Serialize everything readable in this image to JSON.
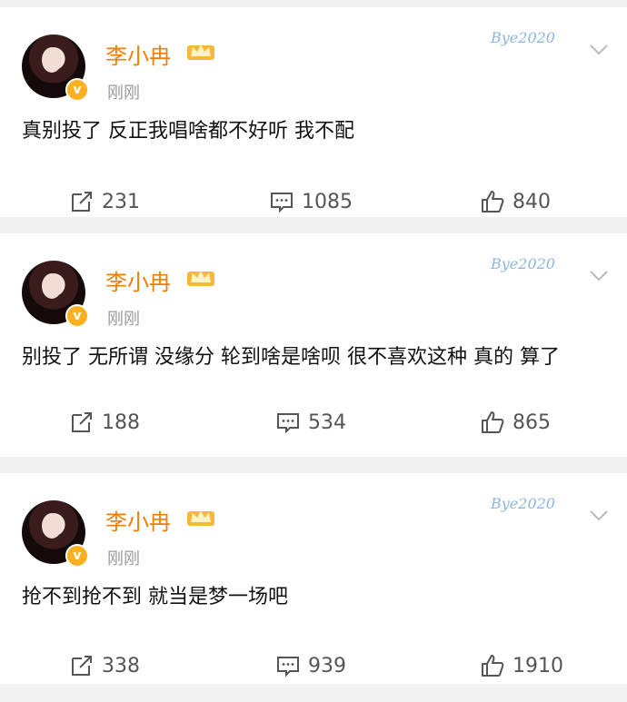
{
  "posts": [
    {
      "author": "李小冉",
      "time": "刚刚",
      "watermark": "Bye2020",
      "text": "真别投了 反正我唱啥都不好听 我不配",
      "reposts": "231",
      "comments": "1085",
      "likes": "840"
    },
    {
      "author": "李小冉",
      "time": "刚刚",
      "watermark": "Bye2020",
      "text": "别投了 无所谓 没缘分 轮到啥是啥呗 很不喜欢这种 真的 算了",
      "reposts": "188",
      "comments": "534",
      "likes": "865"
    },
    {
      "author": "李小冉",
      "time": "刚刚",
      "watermark": "Bye2020",
      "text": "抢不到抢不到 就当是梦一场吧",
      "reposts": "338",
      "comments": "939",
      "likes": "1910"
    }
  ],
  "colors": {
    "author": "#f57c00",
    "verified_badge": "#ffb020",
    "muted": "#999999"
  },
  "icons": {
    "verified": "verified-v-icon",
    "crown": "crown-icon",
    "more": "chevron-down-icon",
    "repost": "repost-icon",
    "comment": "comment-icon",
    "like": "thumbs-up-icon"
  }
}
